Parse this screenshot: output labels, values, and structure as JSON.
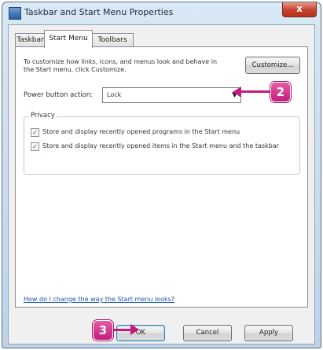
{
  "window": {
    "title": "Taskbar and Start Menu Properties",
    "close_label": "x"
  },
  "tabs": [
    {
      "label": "Taskbar"
    },
    {
      "label": "Start Menu"
    },
    {
      "label": "Toolbars"
    }
  ],
  "start_menu": {
    "description": "To customize how links, icons, and menus look and behave in the Start menu, click Customize.",
    "customize_label": "Customize...",
    "power_button_label": "Power button action:",
    "power_button_value": "Lock",
    "privacy": {
      "label": "Privacy",
      "items": [
        {
          "label": "Store and display recently opened programs in the Start menu",
          "checked": true
        },
        {
          "label": "Store and display recently opened items in the Start menu and the taskbar",
          "checked": true
        }
      ]
    },
    "help_link": "How do I change the way the Start menu looks?"
  },
  "footer": {
    "ok_label": "OK",
    "cancel_label": "Cancel",
    "apply_label": "Apply"
  },
  "callouts": {
    "step_2": "2",
    "step_3": "3"
  },
  "colors": {
    "callout": "#c21d7c",
    "link": "#1d54b7",
    "close": "#c6412c"
  }
}
